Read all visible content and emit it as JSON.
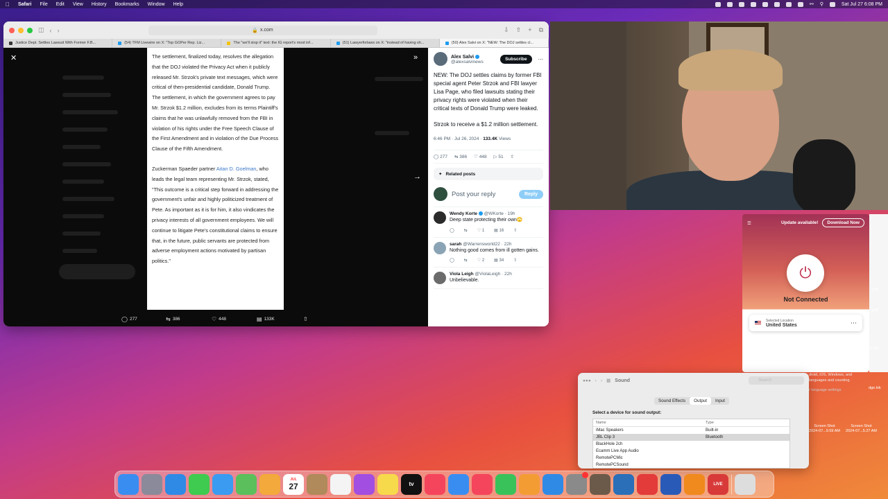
{
  "menubar": {
    "app": "Safari",
    "items": [
      "File",
      "Edit",
      "View",
      "History",
      "Bookmarks",
      "Window",
      "Help"
    ],
    "clock": "Sat Jul 27  6:08 PM"
  },
  "safari": {
    "url": "x.com",
    "tabs": [
      {
        "label": "Justice Dept. Settles Lawsuit With Former F.B...",
        "color": "#333333"
      },
      {
        "label": "(54) TFM Livewire on X: \"Top GOPer Rep. Liz...",
        "color": "#1d9bf0"
      },
      {
        "label": "The \"we'll stop it\" text: the IG report's most inf...",
        "color": "#f5c400"
      },
      {
        "label": "(51) Lawyerforlaws on X: \"instead of having sh...",
        "color": "#1d9bf0"
      },
      {
        "label": "(50) Alex Salvi on X: \"NEW: The DOJ settles cl...",
        "color": "#1d9bf0"
      }
    ],
    "article_paragraphs": [
      "The settlement, finalized today, resolves the allegation that the DOJ violated the Privacy Act when it publicly released Mr. Strzok's private text messages, which were critical of then-presidential candidate, Donald Trump. The settlement, in which the government agrees to pay Mr. Strzok $1.2 million, excludes from its terms Plaintiff's claims that he was unlawfully removed from the FBI in violation of his rights under the Free Speech Clause of the First Amendment and in violation of the Due Process Clause of the Fifth Amendment."
    ],
    "article_p2_prefix": "Zuckerman Spaeder partner ",
    "article_p2_link": "Aitan D. Goelman",
    "article_p2_rest": ", who leads the legal team representing Mr. Strzok, stated, \"This outcome is a critical step forward in addressing the government's unfair and highly politicized treatment of Pete. As important as it is for him, it also vindicates the privacy interests of all government employees. We will continue to litigate Pete's constitutional claims to ensure that, in the future, public servants are protected from adverse employment actions motivated by partisan politics.\"",
    "viewer_actions": {
      "replies": "277",
      "reposts": "386",
      "likes": "448",
      "views": "133K"
    }
  },
  "tweet": {
    "name": "Alex Salvi",
    "handle": "@alexsalvinews",
    "subscribe": "Subscribe",
    "body1": "NEW: The DOJ settles claims by former FBI special agent Peter Strzok and FBI lawyer Lisa Page, who filed lawsuits stating their privacy rights were violated when their critical texts of Donald Trump were leaked.",
    "body2": "Strzok to receive a $1.2 million settlement.",
    "time": "6:46 PM · Jul 26, 2024 · ",
    "views": "133.4K",
    "views_label": " Views",
    "stats": {
      "replies": "277",
      "reposts": "386",
      "likes": "448",
      "bookmarks": "51"
    },
    "related": "Related posts",
    "reply_placeholder": "Post your reply",
    "reply_button": "Reply",
    "replies": [
      {
        "name": "Wendy Korte",
        "handle": "@WKorte · 19h",
        "text": "Deep state protecting their own🙄",
        "likes": "1",
        "views": "16",
        "avatar": "#2b2b2b"
      },
      {
        "name": "sarah",
        "handle": "@Warrensworld22 · 22h",
        "text": "Nothing good comes from ill gotten gains.",
        "likes": "2",
        "views": "34",
        "avatar": "#8aa3b5"
      },
      {
        "name": "Viola Leigh",
        "handle": "@ViolaLeigh · 22h",
        "text": "Unbelievable.",
        "likes": "",
        "views": "",
        "avatar": "#6b6b6b"
      }
    ]
  },
  "vpn": {
    "update": "Update available!",
    "download": "Download Now",
    "status": "Not Connected",
    "location_label": "Selected Location",
    "location": "United States"
  },
  "peek": {
    "help_lines": [
      "droid, iOS, Windows, and",
      "languages and counting.",
      "r language settings"
    ],
    "shots": [
      {
        "title": "Screen Shot",
        "date": "2024-07...9.59 AM"
      },
      {
        "title": "Screen Shot",
        "date": "2024-07...5.27 AM"
      }
    ],
    "files": [
      ".pdf",
      ".pdf",
      "dge.lnk",
      "h.pdf"
    ]
  },
  "sound": {
    "title": "Sound",
    "search": "Search",
    "tabs": [
      "Sound Effects",
      "Output",
      "Input"
    ],
    "active_tab": "Output",
    "label": "Select a device for sound output:",
    "columns": [
      "Name",
      "Type"
    ],
    "devices": [
      {
        "name": "iMac Speakers",
        "type": "Built-in"
      },
      {
        "name": "JBL Clip 3",
        "type": "Bluetooth"
      },
      {
        "name": "BlackHole 2ch",
        "type": ""
      },
      {
        "name": "Ecamm Live App Audio",
        "type": ""
      },
      {
        "name": "RemotePCMic",
        "type": ""
      },
      {
        "name": "RemotePCSound",
        "type": ""
      }
    ],
    "selected_index": 1
  },
  "dock": {
    "calendar_month": "JUL",
    "calendar_day": "27",
    "tv": "tv",
    "live": "LIVE",
    "apps": [
      {
        "name": "finder",
        "color": "#3a8df0"
      },
      {
        "name": "launchpad",
        "color": "#8a8a9a"
      },
      {
        "name": "safari",
        "color": "#2f8ae6"
      },
      {
        "name": "messages",
        "color": "#3ecb4f"
      },
      {
        "name": "mail",
        "color": "#3a9bf0"
      },
      {
        "name": "maps",
        "color": "#5bbf5b"
      },
      {
        "name": "photos",
        "color": "#f3a93b"
      },
      {
        "name": "calendar",
        "color": "#ffffff"
      },
      {
        "name": "contacts",
        "color": "#b08a5a"
      },
      {
        "name": "reminders",
        "color": "#f4f4f4"
      },
      {
        "name": "podcasts",
        "color": "#a24ee0"
      },
      {
        "name": "notes",
        "color": "#f7d94c"
      },
      {
        "name": "tv",
        "color": "#111111"
      },
      {
        "name": "news",
        "color": "#f5455c"
      },
      {
        "name": "keynote",
        "color": "#3a8df0"
      },
      {
        "name": "music",
        "color": "#f5455c"
      },
      {
        "name": "numbers",
        "color": "#3ac25a"
      },
      {
        "name": "pages",
        "color": "#f39c34"
      },
      {
        "name": "app-store",
        "color": "#2f8ae6"
      },
      {
        "name": "system-settings",
        "color": "#8a8a8a"
      },
      {
        "name": "archive",
        "color": "#6b5a4a"
      },
      {
        "name": "remote",
        "color": "#2a6fb8"
      },
      {
        "name": "toolbox",
        "color": "#e33a3a"
      },
      {
        "name": "word",
        "color": "#2a5ab8"
      },
      {
        "name": "vlc",
        "color": "#f08a1e"
      },
      {
        "name": "ecamm-live",
        "color": "#d83a3a"
      },
      {
        "name": "trash",
        "color": "#dddddd"
      }
    ]
  }
}
